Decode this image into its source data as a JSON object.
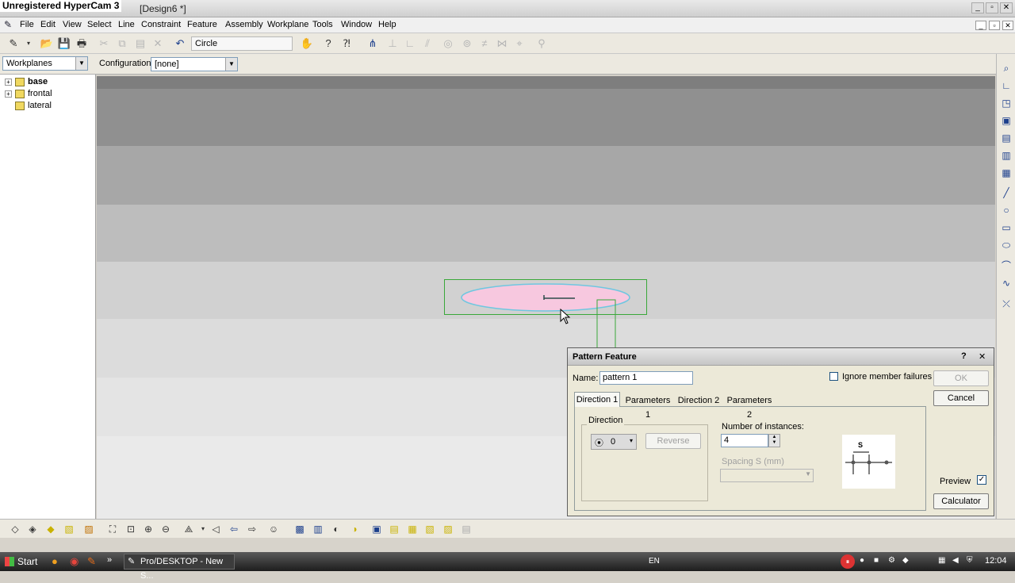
{
  "watermark": "Unregistered HyperCam 3",
  "window": {
    "title": "[Design6 *]"
  },
  "menu": [
    "File",
    "Edit",
    "View",
    "Select",
    "Line",
    "Constraint",
    "Feature",
    "Assembly",
    "Workplane",
    "Tools",
    "Window",
    "Help"
  ],
  "toolbar": {
    "command_text": "Circle"
  },
  "workplane_bar": {
    "selector_value": "Workplanes",
    "configuration_label": "Configuration:",
    "configuration_value": "[none]"
  },
  "tree": {
    "items": [
      {
        "label": "base",
        "bold": true,
        "expandable": true
      },
      {
        "label": "frontal",
        "bold": false,
        "expandable": true
      },
      {
        "label": "lateral",
        "bold": false,
        "expandable": false
      }
    ]
  },
  "dialog": {
    "title": "Pattern Feature",
    "help_btn": "?",
    "close_btn": "✕",
    "name_label": "Name:",
    "name_value": "pattern 1",
    "ignore_label": "Ignore member failures",
    "ok": "OK",
    "cancel": "Cancel",
    "tabs": [
      "Direction 1",
      "Parameters 1",
      "Direction 2",
      "Parameters 2"
    ],
    "direction_group": "Direction",
    "direction_value": "0",
    "reverse": "Reverse",
    "instances_label": "Number of instances:",
    "instances_value": "4",
    "spacing_label": "Spacing S (mm)",
    "diagram_label": "S",
    "preview": "Preview",
    "preview_checked": "✓",
    "calculator": "Calculator"
  },
  "taskbar": {
    "start": "Start",
    "task_item": "Pro/DESKTOP - New S...",
    "language": "EN",
    "clock": "12:04"
  },
  "colors": {
    "ellipse_fill": "#f7c8df",
    "ellipse_stroke": "#6fc7e0",
    "sketch_line": "#3aa83a"
  }
}
